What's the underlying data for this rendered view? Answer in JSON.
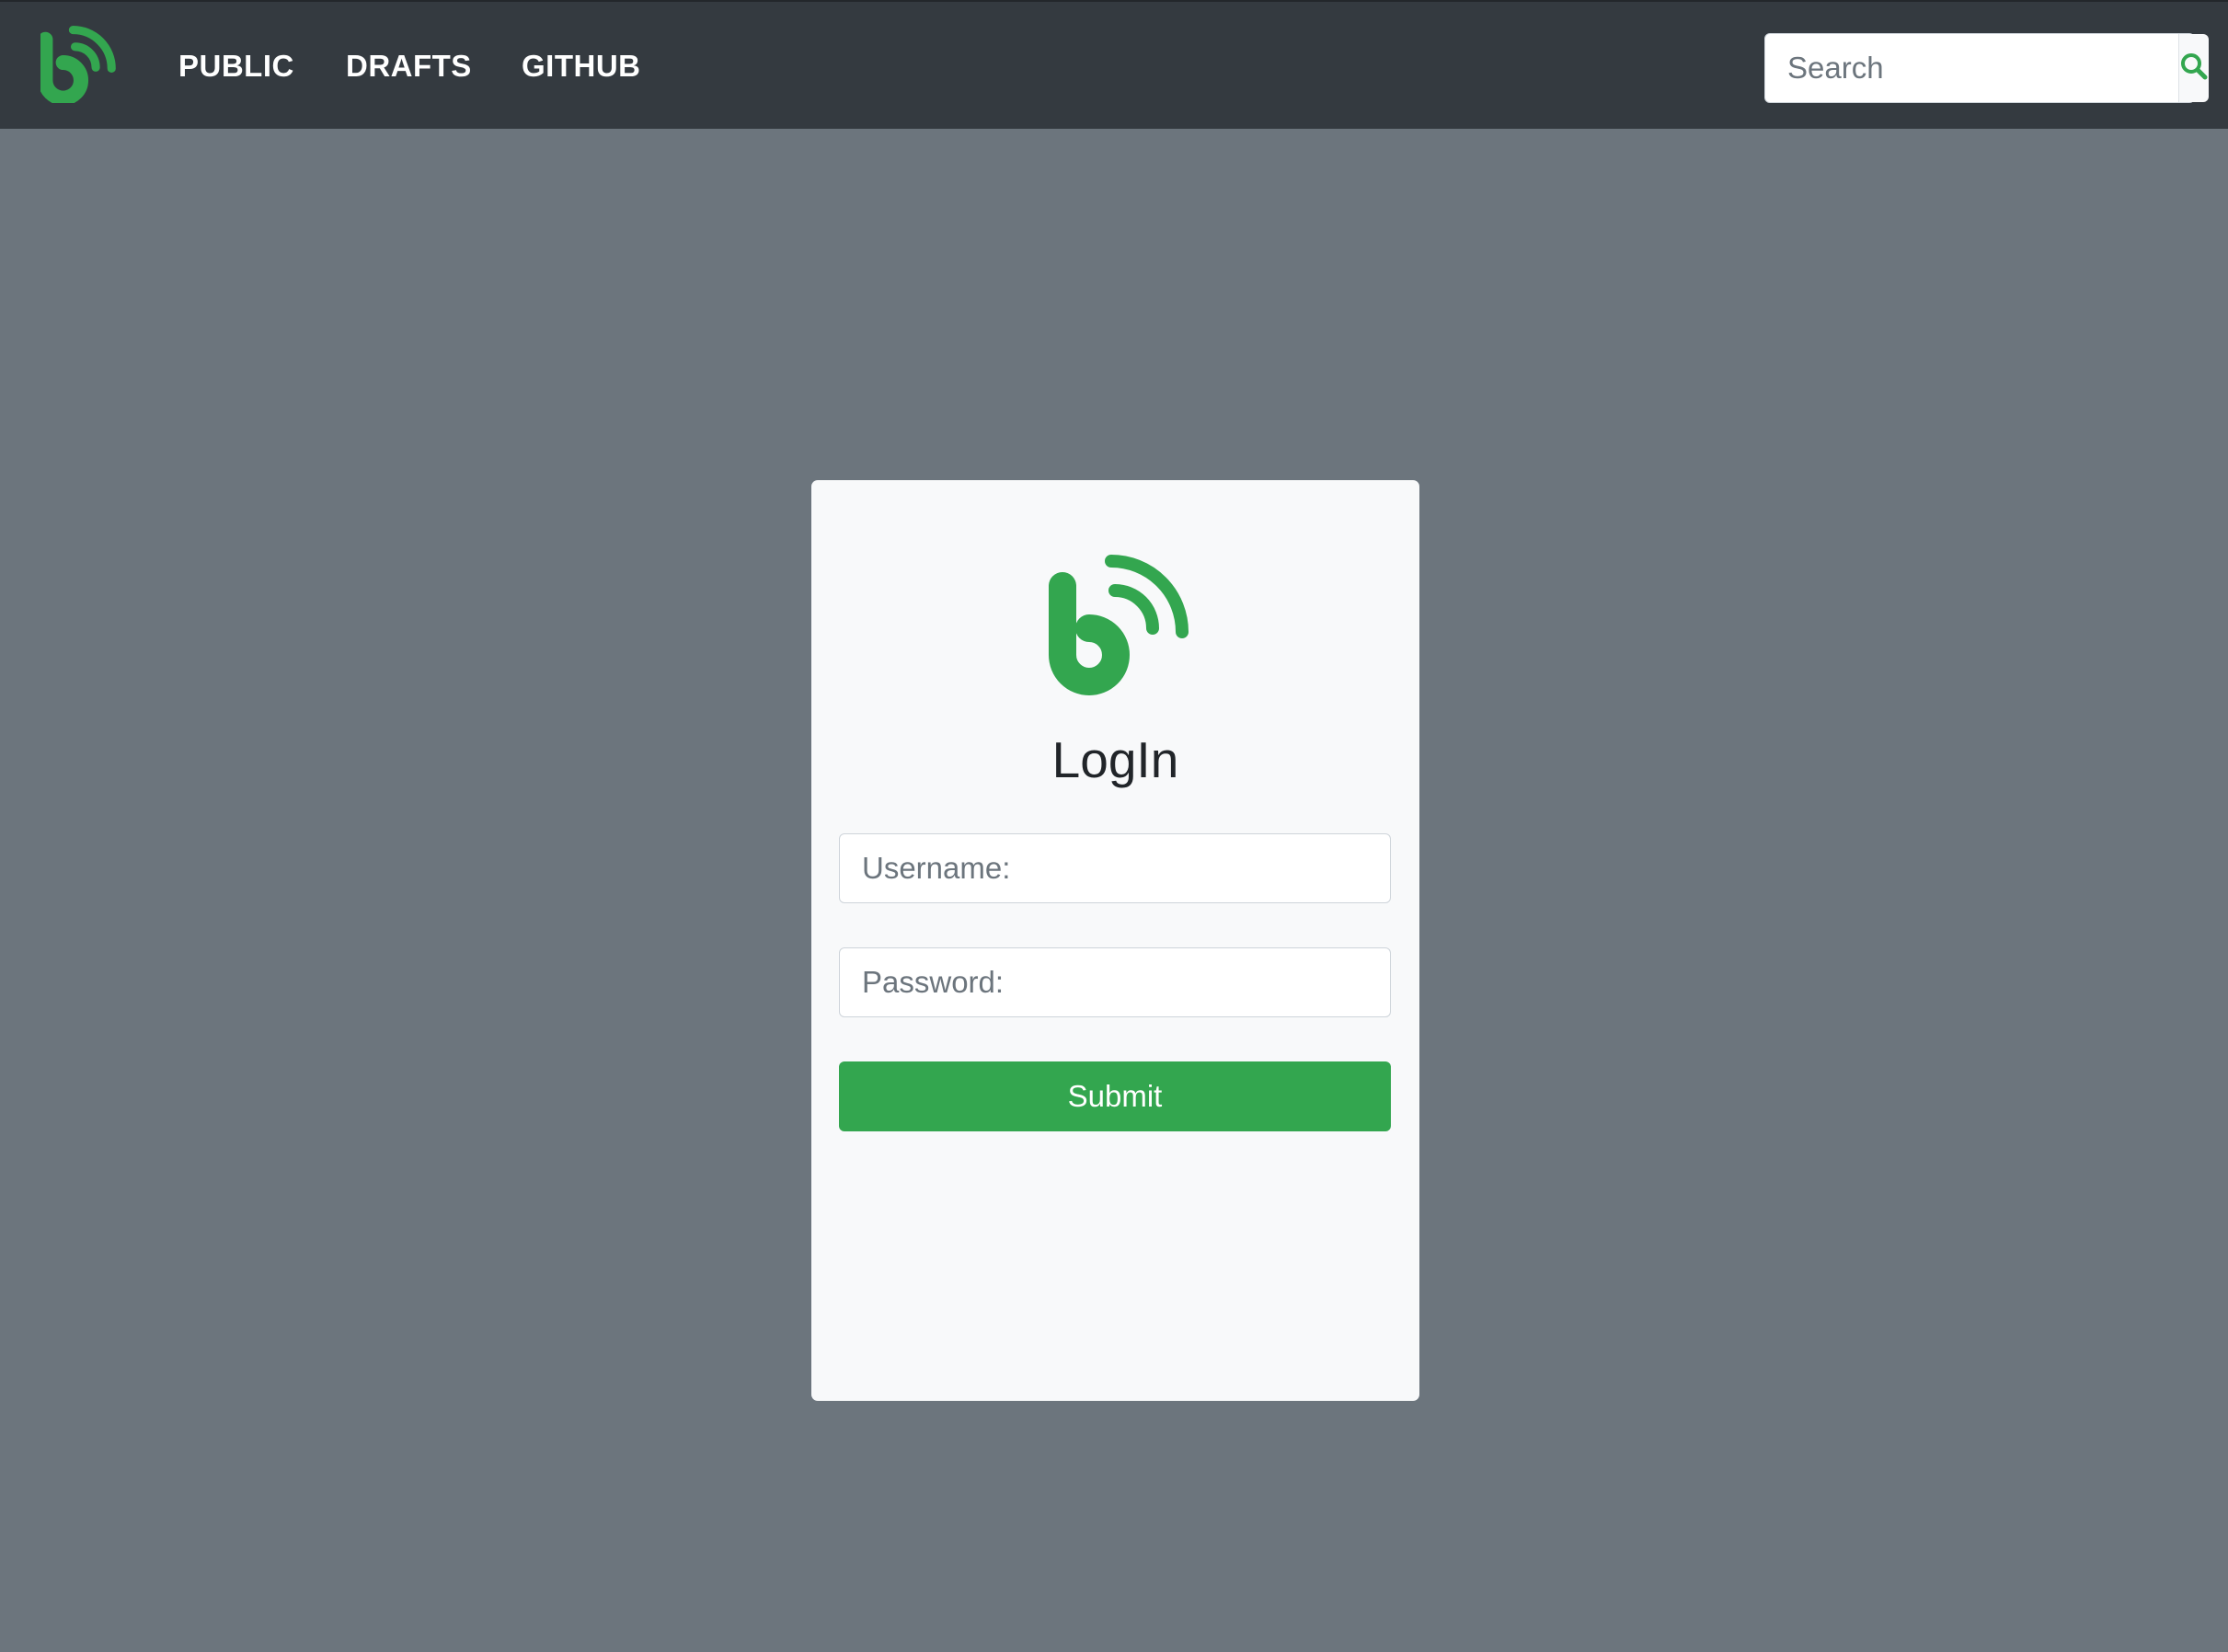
{
  "colors": {
    "navbar_bg": "#343a40",
    "page_bg": "#6c757d",
    "brand_green": "#33a64f",
    "card_bg": "#f8f9fa"
  },
  "navbar": {
    "logo_icon": "brand-b-wifi-logo",
    "links": [
      {
        "label": "PUBLIC"
      },
      {
        "label": "DRAFTS"
      },
      {
        "label": "GITHUB"
      }
    ],
    "search": {
      "placeholder": "Search",
      "value": "",
      "icon": "search-icon"
    }
  },
  "login": {
    "logo_icon": "brand-b-wifi-logo",
    "title": "LogIn",
    "username": {
      "placeholder": "Username:",
      "value": ""
    },
    "password": {
      "placeholder": "Password:",
      "value": ""
    },
    "submit_label": "Submit"
  }
}
